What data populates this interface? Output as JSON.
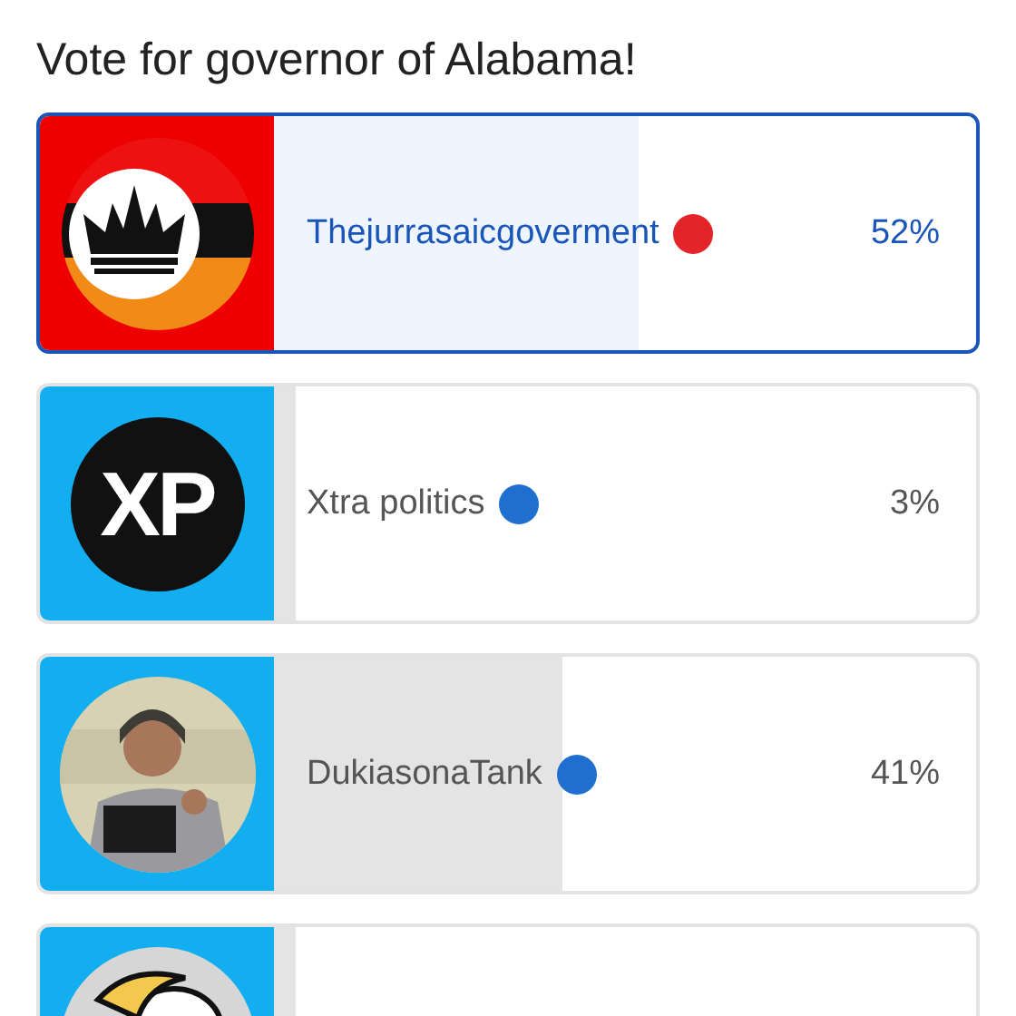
{
  "title": "Vote for governor of Alabama!",
  "options": [
    {
      "kind": "crown-logo",
      "name": "Thejurrasaicgoverment",
      "color": "#e3242b",
      "percent": "52%",
      "level": 0.52,
      "selected": true
    },
    {
      "kind": "text-logo",
      "logo_text": "XP",
      "name": "Xtra politics",
      "color": "#1e6fd0",
      "percent": "3%",
      "level": 0.03,
      "selected": false
    },
    {
      "name": "DukiasonaTank",
      "color": "#1e6fd0",
      "percent": "41%",
      "level": 0.41,
      "selected": false
    },
    {
      "kind": "cartoon",
      "level": 0.03,
      "selected": false
    }
  ]
}
